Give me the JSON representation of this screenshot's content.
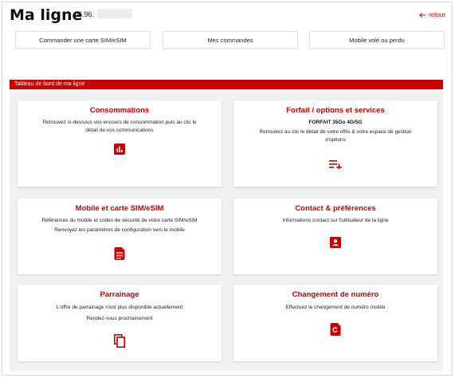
{
  "header": {
    "title": "Ma ligne",
    "phone_prefix": "06.96.",
    "back_label": "retour"
  },
  "quick_actions": [
    {
      "label": "Commander une carte SIM/eSIM"
    },
    {
      "label": "Mes commandes"
    },
    {
      "label": "Mobile volé ou perdu"
    }
  ],
  "dashboard": {
    "title": "Tableau de bord de ma ligne",
    "cards": [
      {
        "title": "Consommations",
        "lines": [
          "Retrouvez ci-dessous vos encours de consommation puis au clic le",
          "détail de vos communications"
        ],
        "icon": "bar-chart-icon"
      },
      {
        "title": "Forfait / options et services",
        "offer": "FORFAIT 35Go 4G/5G",
        "lines": [
          "Retrouvez au clic le détail de votre offre & votre espace de gestion",
          "d'options"
        ],
        "icon": "playlist-add-icon"
      },
      {
        "title": "Mobile et carte SIM/eSIM",
        "lines": [
          "Références du mobile et codes de sécurité de votre carte SIM/eSIM",
          "Renvoyez les paramètres de configuration vers le mobile"
        ],
        "icon": "sim-card-icon"
      },
      {
        "title": "Contact & préférences",
        "lines": [
          "Informations contact sur l'utilisateur de la ligne"
        ],
        "icon": "contact-card-icon"
      },
      {
        "title": "Parrainage",
        "lines": [
          "L'offre de parrainage n'est plus disponible actuellement",
          "Rendez-vous prochainement"
        ],
        "icon": "copy-icon"
      },
      {
        "title": "Changement de numéro",
        "lines": [
          "Effectuez le changement de numéro mobile"
        ],
        "icon": "phone-refresh-icon"
      }
    ]
  },
  "colors": {
    "accent": "#c80000",
    "background": "#f1f1f2"
  }
}
